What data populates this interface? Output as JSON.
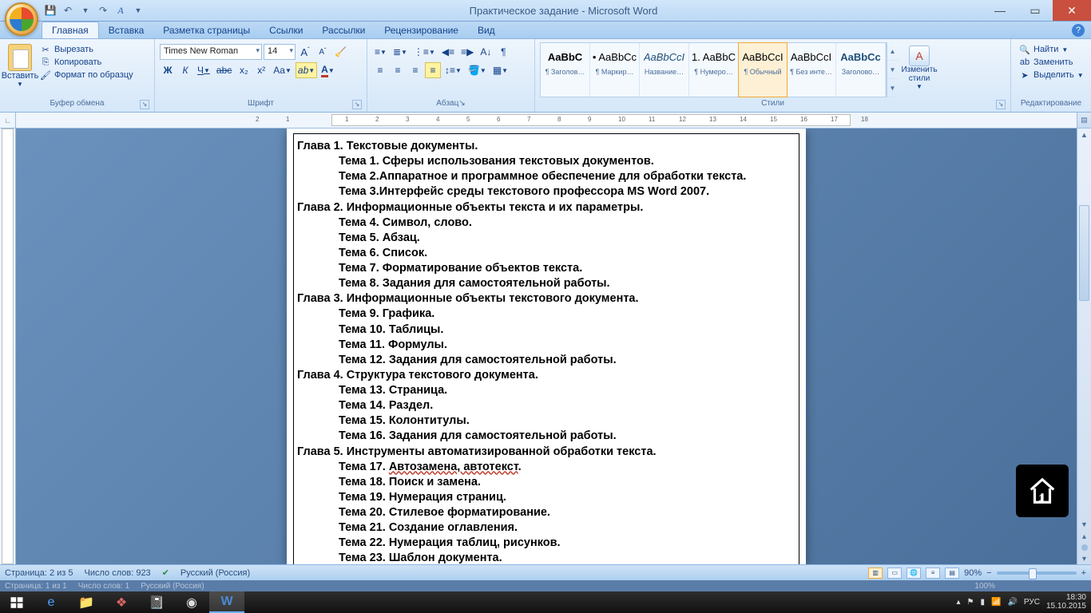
{
  "window": {
    "title": "Практическое задание - Microsoft Word",
    "qat": {
      "save": "💾",
      "undo": "↶",
      "redo": "↷",
      "quickprint": "A"
    }
  },
  "tabs": {
    "items": [
      "Главная",
      "Вставка",
      "Разметка страницы",
      "Ссылки",
      "Рассылки",
      "Рецензирование",
      "Вид"
    ],
    "active": 0
  },
  "ribbon": {
    "clipboard": {
      "label": "Буфер обмена",
      "paste": "Вставить",
      "cut": "Вырезать",
      "copy": "Копировать",
      "format_painter": "Формат по образцу"
    },
    "font": {
      "label": "Шрифт",
      "name": "Times New Roman",
      "size": "14",
      "bold": "Ж",
      "italic": "К",
      "underline": "Ч",
      "strike": "abc",
      "sub": "x₂",
      "sup": "x²",
      "case": "Aa",
      "grow": "A",
      "shrink": "A",
      "clear": "⌫"
    },
    "paragraph": {
      "label": "Абзац"
    },
    "styles": {
      "label": "Стили",
      "items": [
        {
          "preview": "AaBbC",
          "name": "¶ Заголов…",
          "bold": true,
          "color": "#000"
        },
        {
          "preview": "• AaBbCc",
          "name": "¶ Маркир…",
          "color": "#000"
        },
        {
          "preview": "AaBbCcI",
          "name": "Название…",
          "italic": true,
          "color": "#1f4e79"
        },
        {
          "preview": "1. AaBbC",
          "name": "¶ Нумеро…",
          "color": "#000"
        },
        {
          "preview": "AaBbCcI",
          "name": "¶ Обычный",
          "color": "#000",
          "selected": true
        },
        {
          "preview": "AaBbCcI",
          "name": "¶ Без инте…",
          "color": "#000"
        },
        {
          "preview": "AaBbCc",
          "name": "Заголово…",
          "bold": true,
          "color": "#1f4e79"
        }
      ],
      "change": "Изменить стили"
    },
    "editing": {
      "label": "Редактирование",
      "find": "Найти",
      "replace": "Заменить",
      "select": "Выделить"
    }
  },
  "document": {
    "lines": [
      {
        "t": "ch",
        "text": "Глава 1. Текстовые документы."
      },
      {
        "t": "tm",
        "text": "Тема 1. Сферы использования текстовых документов."
      },
      {
        "t": "tm",
        "text": "Тема 2.Аппаратное и программное обеспечение для обработки текста."
      },
      {
        "t": "tm",
        "text": "Тема 3.Интерфейс среды текстового профессора MS Word 2007."
      },
      {
        "t": "ch",
        "text": "Глава 2. Информационные объекты текста и их параметры."
      },
      {
        "t": "tm",
        "text": "Тема 4. Символ, слово."
      },
      {
        "t": "tm",
        "text": "Тема 5. Абзац."
      },
      {
        "t": "tm",
        "text": "Тема 6. Список."
      },
      {
        "t": "tm",
        "text": "Тема 7. Форматирование объектов текста."
      },
      {
        "t": "tm",
        "text": "Тема 8. Задания для самостоятельной работы."
      },
      {
        "t": "ch",
        "text": "Глава 3. Информационные объекты текстового документа."
      },
      {
        "t": "tm",
        "text": "Тема 9. Графика."
      },
      {
        "t": "tm",
        "text": "Тема 10. Таблицы."
      },
      {
        "t": "tm",
        "text": "Тема 11. Формулы."
      },
      {
        "t": "tm",
        "text": "Тема 12.  Задания для самостоятельной работы."
      },
      {
        "t": "ch",
        "text": "Глава 4. Структура текстового документа."
      },
      {
        "t": "tm",
        "text": "Тема 13. Страница."
      },
      {
        "t": "tm",
        "text": "Тема 14. Раздел."
      },
      {
        "t": "tm",
        "text": "Тема 15. Колонтитулы."
      },
      {
        "t": "tm",
        "text": "Тема 16. Задания для самостоятельной работы."
      },
      {
        "t": "ch",
        "text": "Глава 5. Инструменты автоматизированной обработки текста."
      },
      {
        "t": "tm",
        "text": "Тема 17. ",
        "wavy": "Автозамена, автотекст",
        "tail": "."
      },
      {
        "t": "tm",
        "text": "Тема 18. Поиск и замена."
      },
      {
        "t": "tm",
        "text": "Тема 19. Нумерация страниц."
      },
      {
        "t": "tm",
        "text": "Тема 20. Стилевое форматирование."
      },
      {
        "t": "tm",
        "text": "Тема 21. Создание оглавления."
      },
      {
        "t": "tm",
        "text": "Тема 22. Нумерация таблиц, рисунков."
      },
      {
        "t": "tm",
        "text": "Тема 23. Шаблон документа."
      }
    ]
  },
  "status": {
    "page": "Страница: 2 из 5",
    "words": "Число слов: 923",
    "lang": "Русский (Россия)",
    "ghost_page": "Страница: 1 из 1",
    "ghost_words": "Число слов: 1",
    "ghost_lang": "Русский (Россия)",
    "zoom": "90%",
    "ghost_zoom": "100%"
  },
  "taskbar": {
    "lang": "РУС",
    "time": "18:30",
    "date": "15.10.2015"
  },
  "ruler_nums": [
    "2",
    "1",
    "1",
    "2",
    "3",
    "4",
    "5",
    "6",
    "7",
    "8",
    "9",
    "10",
    "11",
    "12",
    "13",
    "14",
    "15",
    "16",
    "17",
    "18"
  ]
}
